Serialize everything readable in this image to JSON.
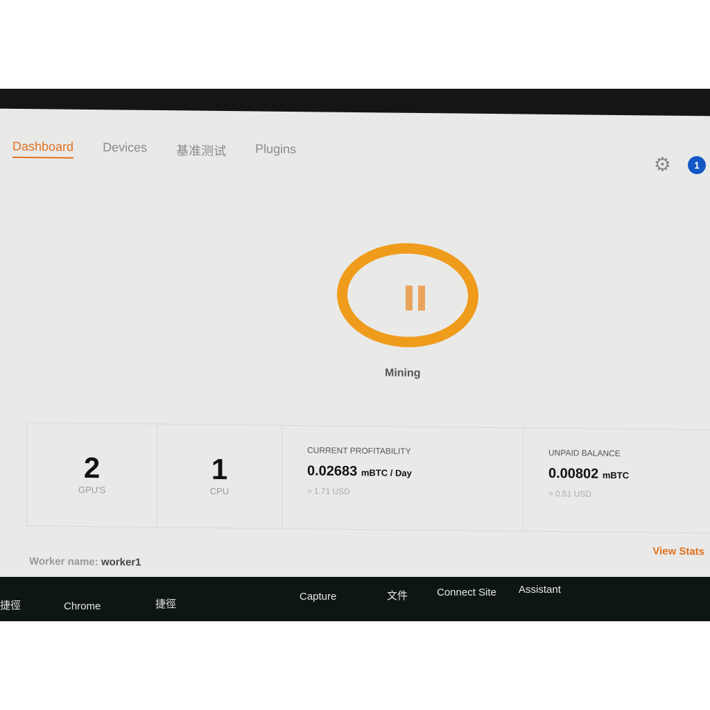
{
  "nav": {
    "tabs": [
      {
        "label": "Dashboard",
        "active": true
      },
      {
        "label": "Devices"
      },
      {
        "label": "基准测试"
      },
      {
        "label": "Plugins"
      }
    ],
    "notification_count": "1"
  },
  "status": {
    "label": "Mining",
    "icon": "pause-icon",
    "accent": "#ef9b1c"
  },
  "stats": {
    "gpus": {
      "value": "2",
      "label": "GPU'S"
    },
    "cpus": {
      "value": "1",
      "label": "CPU"
    },
    "profitability": {
      "title": "CURRENT PROFITABILITY",
      "value": "0.02683",
      "unit": "mBTC / Day",
      "usd": "≈ 1.71 USD"
    },
    "balance": {
      "title": "UNPAID BALANCE",
      "value": "0.00802",
      "unit": "mBTC",
      "usd": "≈ 0.51 USD"
    }
  },
  "view_stats": "View Stats",
  "worker": {
    "label": "Worker name:",
    "name": "worker1"
  },
  "taskbar": [
    "捷徑",
    "Chrome",
    "捷徑",
    "Capture",
    "文件",
    "Connect Site",
    "Assistant"
  ]
}
